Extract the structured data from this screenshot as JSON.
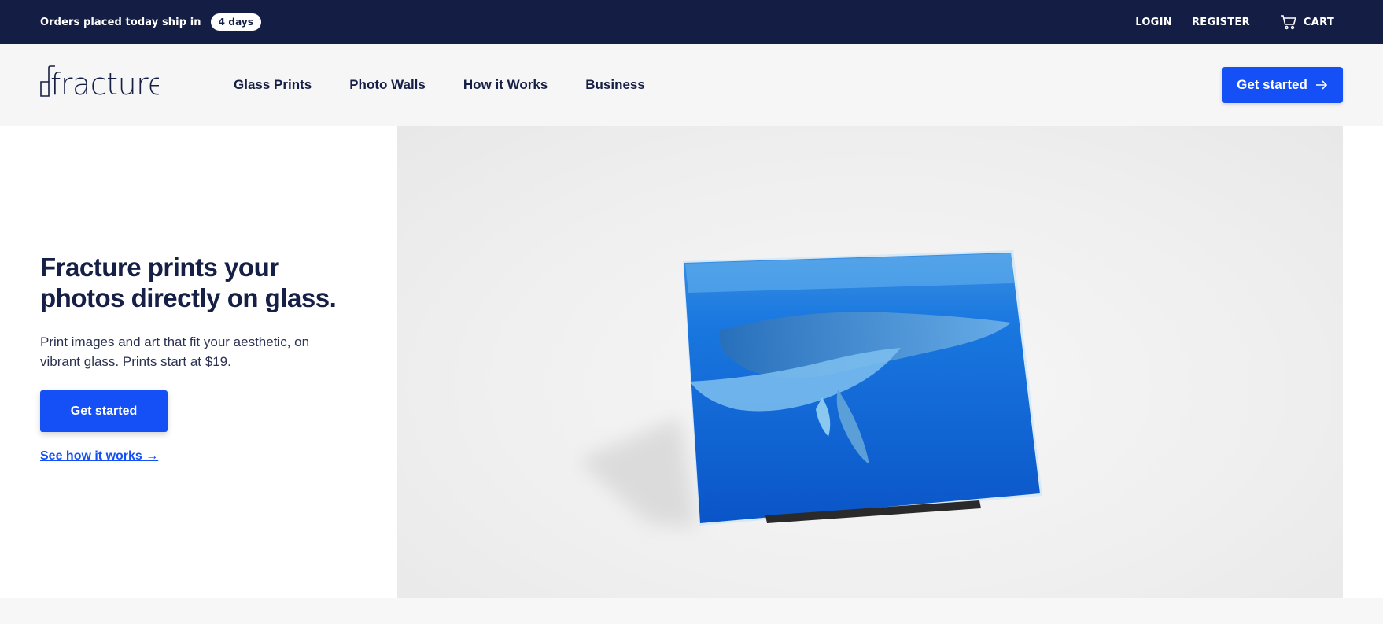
{
  "announcement": {
    "text": "Orders placed today ship in",
    "badge": "4 days"
  },
  "utility_nav": {
    "login": "LOGIN",
    "register": "REGISTER",
    "cart": "CART"
  },
  "header": {
    "logo_text": "fracture",
    "menu": [
      {
        "label": "Glass Prints"
      },
      {
        "label": "Photo Walls"
      },
      {
        "label": "How it Works"
      },
      {
        "label": "Business"
      }
    ],
    "cta_label": "Get started",
    "cta_icon": "arrow-right-icon"
  },
  "hero": {
    "headline_line1": "Fracture prints your",
    "headline_line2": "photos directly on glass.",
    "subtext": "Print images and art that fit your aesthetic, on vibrant glass. Prints start at $19.",
    "cta_label": "Get started",
    "link_label": "See how it works →",
    "image_alt": "Glass print of humpback whales on a stand"
  },
  "colors": {
    "navy": "#141e45",
    "brand_blue": "#1450f5",
    "background_gray": "#f6f6f6"
  }
}
